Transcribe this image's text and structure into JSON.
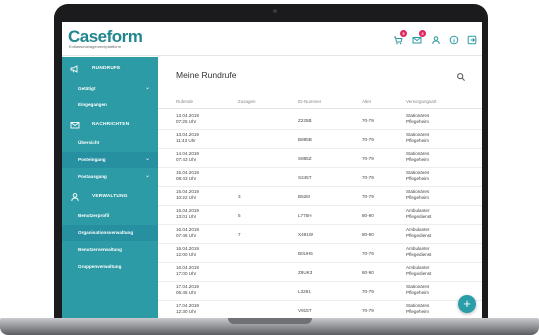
{
  "header": {
    "logo_text": "Caseform",
    "logo_subtitle": "Entlassmanagementplattform",
    "cart_badge": "5",
    "mail_badge": "3"
  },
  "sidebar": {
    "sections": [
      {
        "icon": "megaphone-icon",
        "label": "RUNDRUFE"
      },
      {
        "icon": "mail-icon",
        "label": "NACHRICHTEN"
      },
      {
        "icon": "user-icon",
        "label": "VERWALTUNG"
      }
    ],
    "items": [
      {
        "label": "Getätigt"
      },
      {
        "label": "Eingegangen"
      },
      {
        "label": "Übersicht"
      },
      {
        "label": "Posteingang"
      },
      {
        "label": "Postausgang"
      },
      {
        "label": "Benutzerprofil"
      },
      {
        "label": "Organisationsverwaltung"
      },
      {
        "label": "Benutzerverwaltung"
      },
      {
        "label": "Gruppenverwaltung"
      }
    ]
  },
  "main": {
    "title": "Meine Rundrufe",
    "columns": [
      "Rufende",
      "Zusagen",
      "ID-Nummer",
      "Alter",
      "Versorgungsart"
    ],
    "rows": [
      {
        "date": "13.04.2019",
        "time": "07:25 Uhr",
        "zusagen": "",
        "id": "Z225B",
        "alter": "70-79",
        "art1": "Stationäres",
        "art2": "Pflegeheim"
      },
      {
        "date": "13.04.2019",
        "time": "11:43 Uhr",
        "zusagen": "",
        "id": "B885B",
        "alter": "70-79",
        "art1": "Stationäres",
        "art2": "Pflegeheim"
      },
      {
        "date": "14.04.2019",
        "time": "07:43 Uhr",
        "zusagen": "",
        "id": "S885Z",
        "alter": "70-79",
        "art1": "Stationäres",
        "art2": "Pflegeheim"
      },
      {
        "date": "15.04.2019",
        "time": "08:43 Uhr",
        "zusagen": "",
        "id": "S245T",
        "alter": "70-79",
        "art1": "Stationäres",
        "art2": "Pflegeheim"
      },
      {
        "date": "15.04.2019",
        "time": "10:22 Uhr",
        "zusagen": "3",
        "id": "B528I",
        "alter": "70-79",
        "art1": "Stationäres",
        "art2": "Pflegeheim"
      },
      {
        "date": "15.04.2019",
        "time": "13:01 Uhr",
        "zusagen": "5",
        "id": "L775H",
        "alter": "80-90",
        "art1": "Ambulanter",
        "art2": "Pflegedienst"
      },
      {
        "date": "16.04.2019",
        "time": "07:46 Uhr",
        "zusagen": "7",
        "id": "X491W",
        "alter": "80-90",
        "art1": "Ambulanter",
        "art2": "Pflegedienst"
      },
      {
        "date": "16.04.2019",
        "time": "12:00 Uhr",
        "zusagen": "",
        "id": "B0UH5",
        "alter": "70-79",
        "art1": "Ambulanter",
        "art2": "Pflegedienst"
      },
      {
        "date": "16.04.2019",
        "time": "17:00 Uhr",
        "zusagen": "",
        "id": "Z9UK3",
        "alter": "80-90",
        "art1": "Ambulanter",
        "art2": "Pflegedienst"
      },
      {
        "date": "17.04.2019",
        "time": "06:45 Uhr",
        "zusagen": "",
        "id": "L3281",
        "alter": "70-79",
        "art1": "Stationäres",
        "art2": "Pflegeheim"
      },
      {
        "date": "17.04.2019",
        "time": "12:30 Uhr",
        "zusagen": "",
        "id": "V915T",
        "alter": "70-79",
        "art1": "Stationäres",
        "art2": "Pflegeheim"
      }
    ]
  },
  "fab_label": "+",
  "colors": {
    "accent": "#2c9ba5",
    "badge": "#e0245e"
  }
}
